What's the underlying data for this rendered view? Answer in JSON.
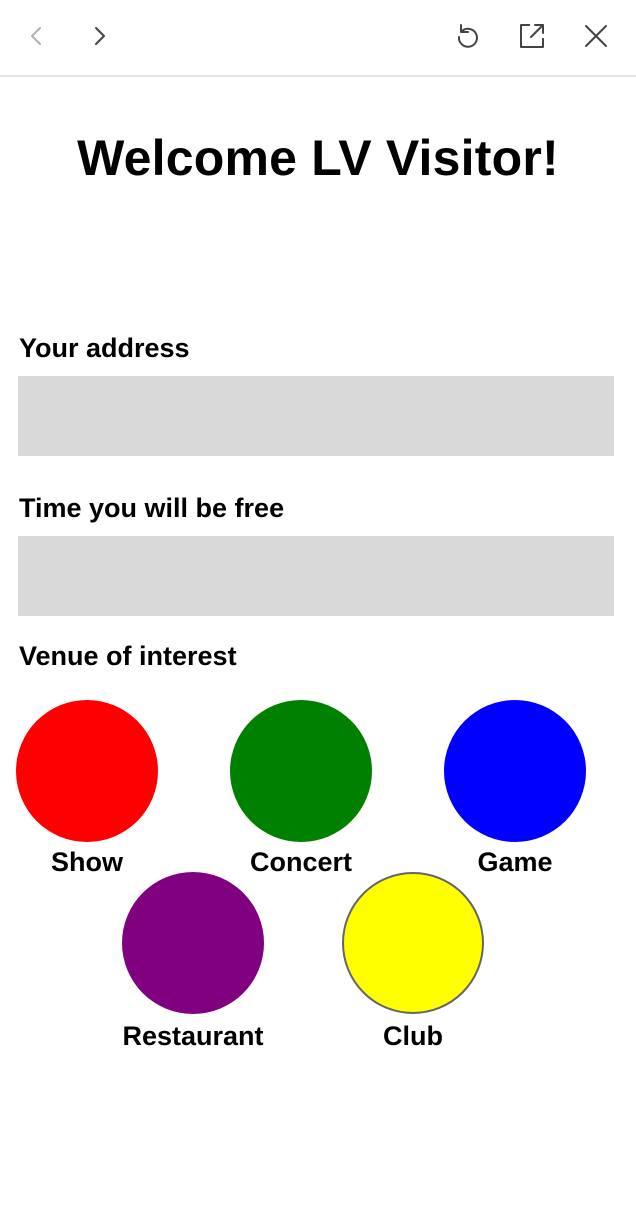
{
  "toolbar": {
    "back_icon": "chevron-left-icon",
    "forward_icon": "chevron-right-icon",
    "reload_icon": "reload-icon",
    "open_external_icon": "open-external-icon",
    "close_icon": "close-icon"
  },
  "page": {
    "title": "Welcome LV Visitor!"
  },
  "form": {
    "address": {
      "label": "Your address",
      "value": "",
      "placeholder": ""
    },
    "time": {
      "label": "Time you will be free",
      "value": "",
      "placeholder": ""
    },
    "venue": {
      "label": "Venue of interest",
      "options": [
        {
          "label": "Show",
          "color": "#ff0000"
        },
        {
          "label": "Concert",
          "color": "#008000"
        },
        {
          "label": "Game",
          "color": "#0000ff"
        },
        {
          "label": "Restaurant",
          "color": "#800080"
        },
        {
          "label": "Club",
          "color": "#ffff00"
        }
      ]
    }
  },
  "colors": {
    "input_background": "#d9d9d9",
    "toolbar_icon_active": "#444444",
    "toolbar_icon_disabled": "#b0b0b0"
  }
}
